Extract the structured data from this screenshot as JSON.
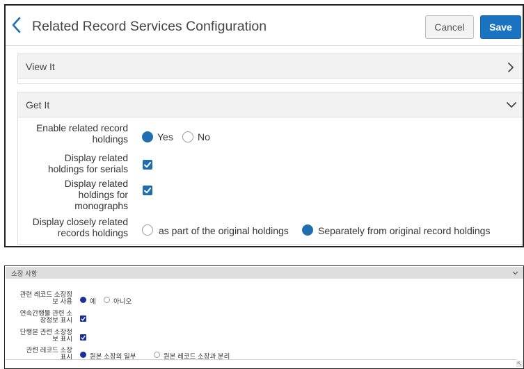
{
  "header": {
    "title": "Related Record Services Configuration",
    "cancel_label": "Cancel",
    "save_label": "Save"
  },
  "sections": {
    "view_it": {
      "label": "View It",
      "expanded": false
    },
    "get_it": {
      "label": "Get It",
      "expanded": true
    }
  },
  "get_it_fields": {
    "enable": {
      "label_line1": "Enable related record",
      "label_line2": "holdings",
      "options": [
        "Yes",
        "No"
      ],
      "selected": "Yes"
    },
    "serials": {
      "label_line1": "Display related",
      "label_line2": "holdings for serials",
      "checked": true
    },
    "monographs": {
      "label_line1": "Display related",
      "label_line2": "holdings for",
      "label_line3": "monographs",
      "checked": true
    },
    "closely": {
      "label_line1": "Display closely related",
      "label_line2": "records holdings",
      "options": [
        "as part of the original holdings",
        "Separately from original record holdings"
      ],
      "selected": "Separately from original record holdings"
    }
  },
  "korean": {
    "section_label": "소장 사항",
    "enable": {
      "label_line1": "관련 레코드 소장정",
      "label_line2": "보 사용",
      "options": [
        "예",
        "아니오"
      ],
      "selected": "예"
    },
    "serials": {
      "label_line1": "연속간행물 관련 소",
      "label_line2": "장정보 표시",
      "checked": true
    },
    "monographs": {
      "label_line1": "단행본 관련 소장정",
      "label_line2": "보 표시",
      "checked": true
    },
    "closely": {
      "label_line1": "관련 레코드 소장",
      "label_line2": "표시",
      "options": [
        "원본 소장의 일부",
        "원본 레코드 소장과 분리"
      ],
      "selected": "원본 소장의 일부"
    }
  },
  "colors": {
    "accent": "#1f6fb0",
    "save_button": "#1a73c0",
    "korean_accent": "#1a2f9a",
    "section_header_bg": "#f2f2f2"
  },
  "icons": [
    "chevron-left-icon",
    "chevron-right-icon",
    "chevron-down-icon",
    "checkmark-icon",
    "resize-handle-icon"
  ]
}
